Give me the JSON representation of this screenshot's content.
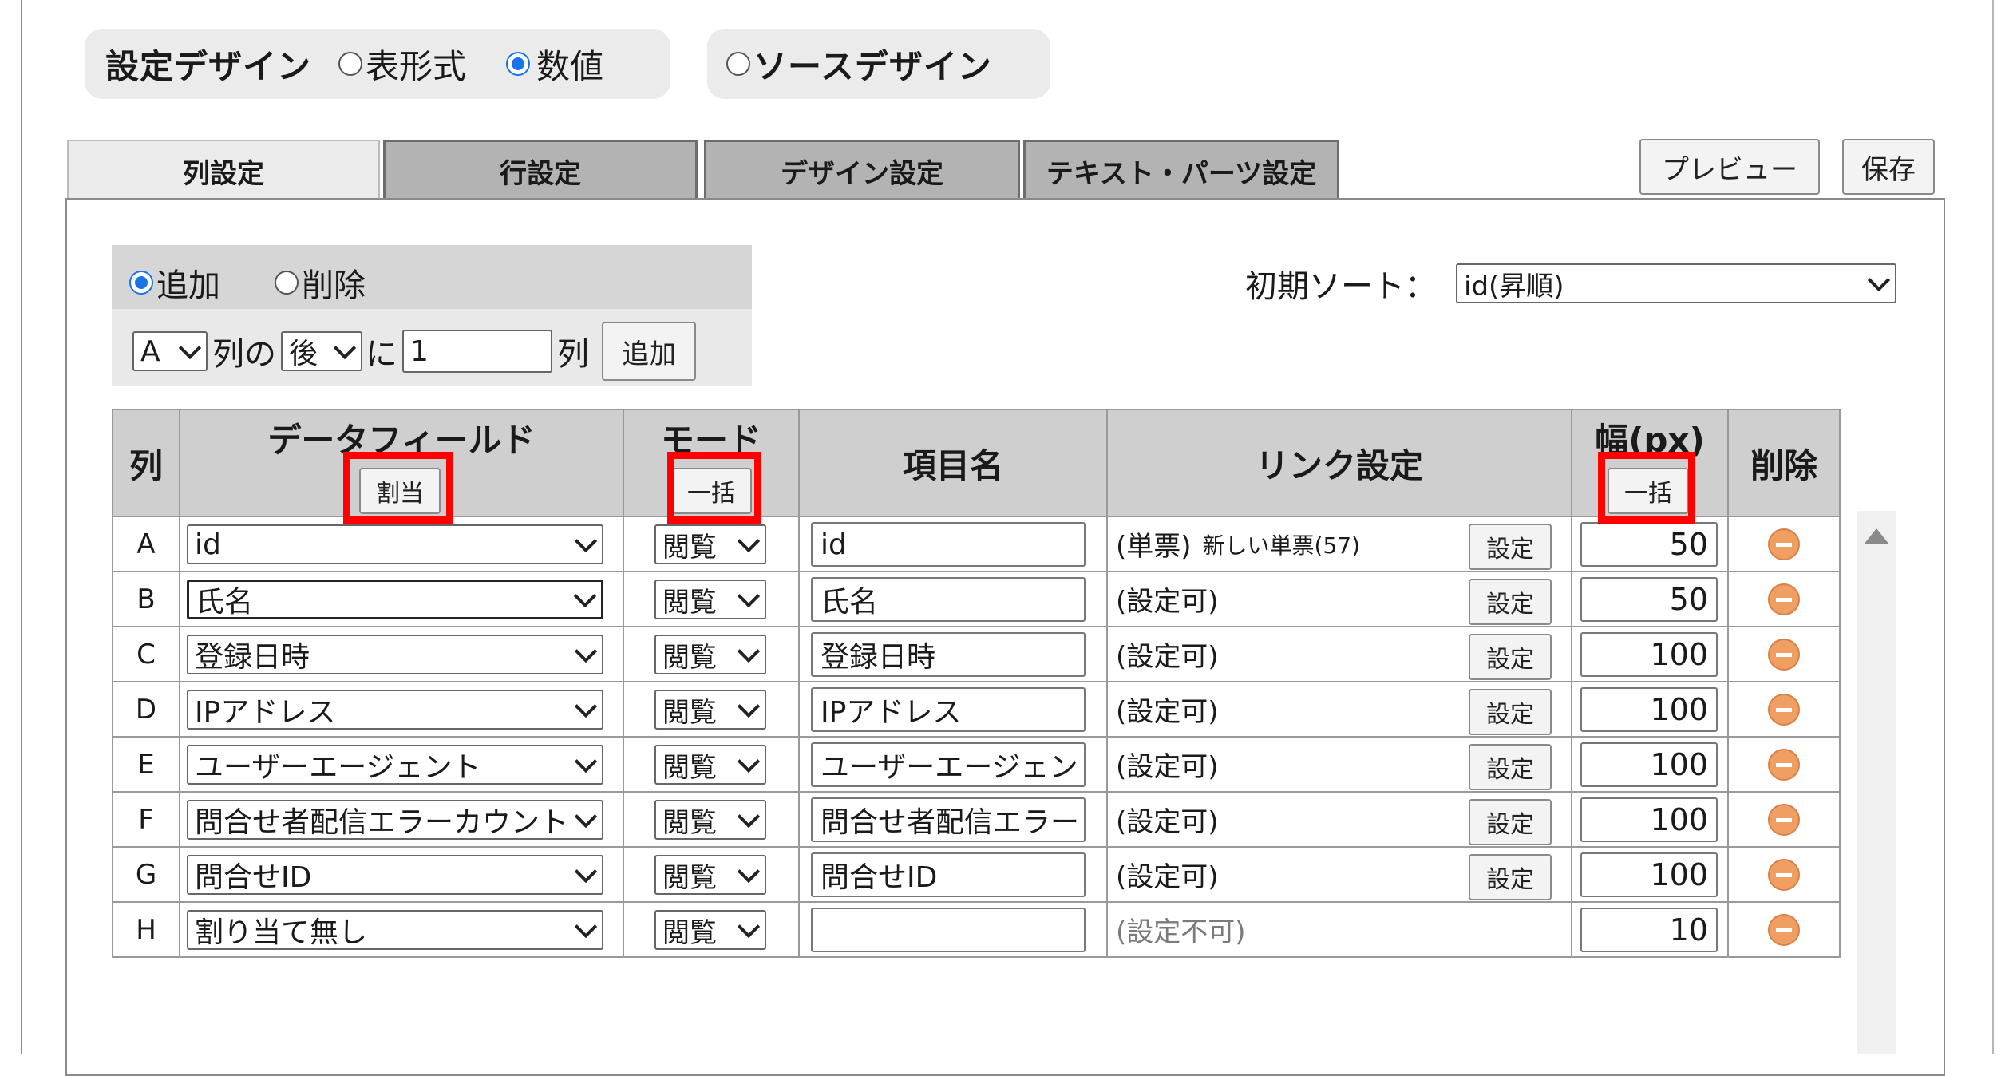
{
  "design_mode": {
    "label": "設定デザイン",
    "options": [
      {
        "label": "表形式",
        "selected": false
      },
      {
        "label": "数値",
        "selected": true
      }
    ],
    "source_option": {
      "label": "ソースデザイン",
      "selected": false
    }
  },
  "tabs": [
    {
      "label": "列設定",
      "active": true
    },
    {
      "label": "行設定",
      "active": false
    },
    {
      "label": "デザイン設定",
      "active": false
    },
    {
      "label": "テキスト・パーツ設定",
      "active": false
    }
  ],
  "toolbar": {
    "preview_label": "プレビュー",
    "save_label": "保存"
  },
  "add_panel": {
    "add_label": "追加",
    "delete_label": "削除",
    "column_value": "A",
    "text_column_of": "列の",
    "position_value": "後",
    "text_ni": "に",
    "count_value": "1",
    "text_retsu": "列",
    "add_button": "追加"
  },
  "initial_sort": {
    "label": "初期ソート：",
    "value": "id(昇順)"
  },
  "table": {
    "headers": {
      "col": "列",
      "datafield": "データフィールド",
      "datafield_btn": "割当",
      "mode": "モード",
      "mode_btn": "一括",
      "item_name": "項目名",
      "link": "リンク設定",
      "width": "幅(px)",
      "width_btn": "一括",
      "delete": "削除"
    },
    "set_button": "設定",
    "rows": [
      {
        "col": "A",
        "field": "id",
        "mode": "閲覧",
        "name": "id",
        "link": "(単票)",
        "link_note": "新しい単票(57)",
        "has_set": true,
        "width": "50"
      },
      {
        "col": "B",
        "field": "氏名",
        "mode": "閲覧",
        "name": "氏名",
        "link": "(設定可)",
        "link_note": "",
        "has_set": true,
        "width": "50"
      },
      {
        "col": "C",
        "field": "登録日時",
        "mode": "閲覧",
        "name": "登録日時",
        "link": "(設定可)",
        "link_note": "",
        "has_set": true,
        "width": "100"
      },
      {
        "col": "D",
        "field": "IPアドレス",
        "mode": "閲覧",
        "name": "IPアドレス",
        "link": "(設定可)",
        "link_note": "",
        "has_set": true,
        "width": "100"
      },
      {
        "col": "E",
        "field": "ユーザーエージェント",
        "mode": "閲覧",
        "name": "ユーザーエージェン",
        "link": "(設定可)",
        "link_note": "",
        "has_set": true,
        "width": "100"
      },
      {
        "col": "F",
        "field": "問合せ者配信エラーカウント",
        "mode": "閲覧",
        "name": "問合せ者配信エラー",
        "link": "(設定可)",
        "link_note": "",
        "has_set": true,
        "width": "100"
      },
      {
        "col": "G",
        "field": "問合せID",
        "mode": "閲覧",
        "name": "問合せID",
        "link": "(設定可)",
        "link_note": "",
        "has_set": true,
        "width": "100"
      },
      {
        "col": "H",
        "field": "割り当て無し",
        "mode": "閲覧",
        "name": "",
        "link": "(設定不可)",
        "link_note": "",
        "has_set": false,
        "width": "10"
      }
    ]
  },
  "colors": {
    "accent": "#1a73e8",
    "highlight": "#ff0000",
    "delete_icon": "#f09f63"
  }
}
